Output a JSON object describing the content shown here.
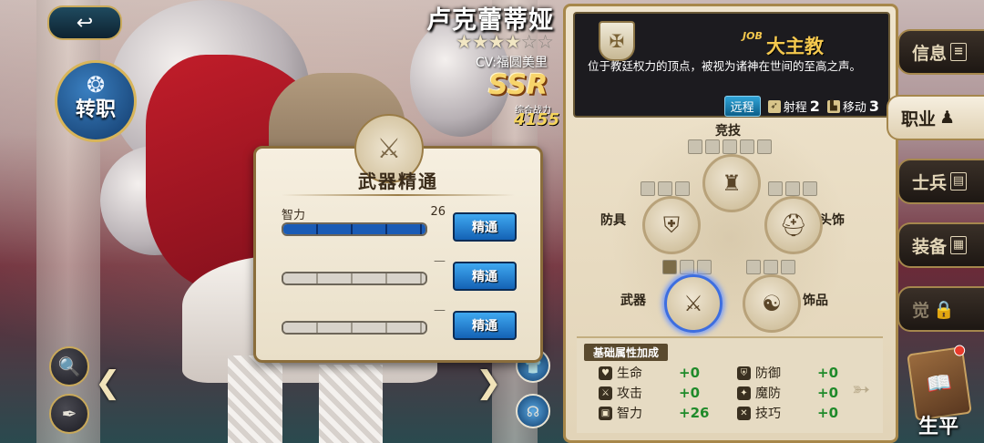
{
  "character": {
    "name": "卢克蕾蒂娅",
    "stars_on": "★★★★",
    "stars_off": "☆☆",
    "rating_filled": 4,
    "rating_max": 6,
    "cv": "CV:福圆美里",
    "rarity": "SSR",
    "power_label": "综合战力",
    "power": "4155"
  },
  "left_controls": {
    "back_icon": "↩",
    "reclass_label": "转职",
    "reclass_icon": "❂",
    "search_icon": "🔍",
    "quill_icon": "✒"
  },
  "mastery": {
    "title": "武器精通",
    "emblem_icon": "⚔",
    "rows": [
      {
        "stat": "智力",
        "value": "26",
        "progress": 1.0,
        "button": "精通"
      },
      {
        "stat": "",
        "value": "",
        "progress": 0.0,
        "button": "精通"
      },
      {
        "stat": "",
        "value": "",
        "progress": 0.0,
        "button": "精通"
      }
    ]
  },
  "job": {
    "badge_icon": "✠",
    "en_tag": "JOB",
    "name": "大主教",
    "description": "位于教廷权力的顶点，被视为诸神在世间的至高之声。",
    "range_tag": "远程",
    "range_label": "射程",
    "range_value": "2",
    "move_label": "移动",
    "move_value": "3"
  },
  "equipment": {
    "arena_label": "竞技",
    "armor_label": "防具",
    "head_label": "头饰",
    "weapon_label": "武器",
    "accessory_label": "饰品",
    "arena_icon": "♜",
    "armor_icon": "⛨",
    "head_icon": "⛑",
    "weapon_icon": "⚔",
    "accessory_icon": "☯"
  },
  "base_stats": {
    "title": "基础属性加成",
    "hp_label": "生命",
    "hp_value": "+0",
    "def_label": "防御",
    "def_value": "+0",
    "atk_label": "攻击",
    "atk_value": "+0",
    "mdef_label": "魔防",
    "mdef_value": "+0",
    "int_label": "智力",
    "int_value": "+26",
    "tec_label": "技巧",
    "tec_value": "+0"
  },
  "tabs": [
    {
      "label": "信息",
      "icon": "≡"
    },
    {
      "label": "职业",
      "icon": "♟"
    },
    {
      "label": "士兵",
      "icon": "▤"
    },
    {
      "label": "装备",
      "icon": "▦"
    },
    {
      "label": "觉",
      "icon": "🔒"
    }
  ],
  "biography_label": "生平",
  "colors": {
    "accent_gold": "#a7874a",
    "mastery_blue": "#1a5bb5",
    "bonus_green": "#1f8a2a",
    "job_gold": "#f4c84e"
  }
}
